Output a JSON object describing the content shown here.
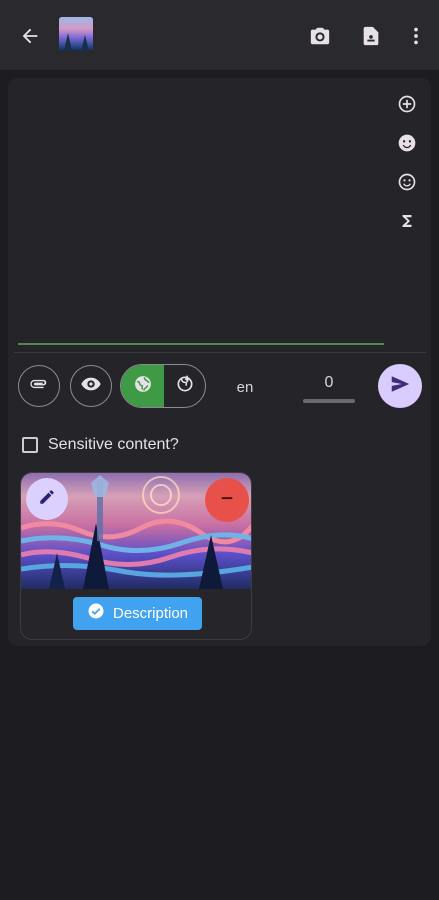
{
  "header": {
    "back": "back-arrow-icon",
    "thumbnail": "account-thumbnail",
    "actions": [
      "camera-icon",
      "document-icon",
      "more-vert-icon"
    ]
  },
  "composer": {
    "side_actions": [
      "add-circle-icon",
      "emoji-icon",
      "smiley-icon",
      "sigma-icon"
    ]
  },
  "toolbar": {
    "language": "en",
    "char_count": "0"
  },
  "sensitive": {
    "label": "Sensitive content?"
  },
  "attachment": {
    "description_label": "Description"
  },
  "colors": {
    "accent": "#d9cdff",
    "visibility_on": "#3f9a45",
    "remove": "#e8504a",
    "description": "#41a3f0"
  }
}
